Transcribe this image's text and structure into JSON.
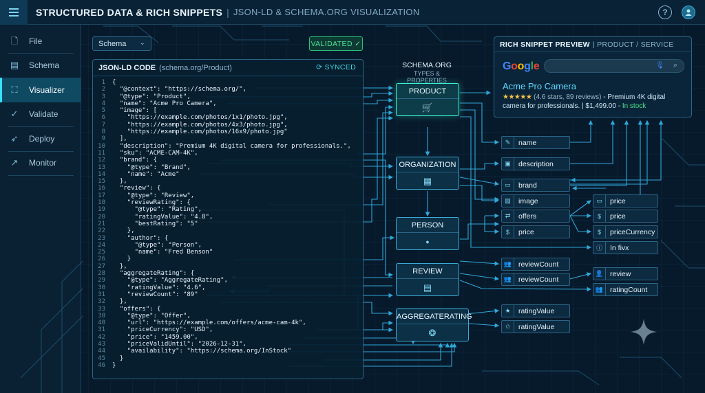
{
  "header": {
    "title": "STRUCTURED DATA & RICH SNIPPETS",
    "separator": "|",
    "subtitle": "JSON-LD & SCHEMA.ORG VISUALIZATION",
    "help_icon": "?",
    "icons": [
      "menu-icon",
      "help-icon",
      "user-icon"
    ]
  },
  "sidebar": {
    "items": [
      {
        "label": "File",
        "icon": "file-icon",
        "glyph": "🗋"
      },
      {
        "label": "Schema",
        "icon": "schema-icon",
        "glyph": "▤"
      },
      {
        "label": "Visualizer",
        "icon": "visualizer-icon",
        "glyph": "⛶"
      },
      {
        "label": "Validate",
        "icon": "check-circle-icon",
        "glyph": "✓"
      },
      {
        "label": "Deploy",
        "icon": "rocket-icon",
        "glyph": "➶"
      },
      {
        "label": "Monitor",
        "icon": "chart-icon",
        "glyph": "↗"
      }
    ],
    "active": "Visualizer"
  },
  "toolbar": {
    "schema_select": "Schema",
    "validated": "VALIDATED ✓"
  },
  "code_panel": {
    "title": "JSON-LD CODE",
    "subtitle": "(schema.org/Product)",
    "synced": "⟳ SYNCED",
    "lines": [
      {
        "n": "1",
        "t": "{"
      },
      {
        "n": "2",
        "t": "  \"@context\": \"https://schema.org/\","
      },
      {
        "n": "3",
        "t": "  \"@type\": \"Product\","
      },
      {
        "n": "4",
        "t": "  \"name\": \"Acme Pro Camera\","
      },
      {
        "n": "5",
        "t": "  \"image\": ["
      },
      {
        "n": "6",
        "t": "    \"https://example.com/photos/1x1/photo.jpg\","
      },
      {
        "n": "7",
        "t": "    \"https://example.com/photos/4x3/photo.jpg\","
      },
      {
        "n": "8",
        "t": "    \"https://example.com/photos/16x9/photo.jpg\""
      },
      {
        "n": "9",
        "t": "  ],"
      },
      {
        "n": "10",
        "t": "  \"description\": \"Premium 4K digital camera for professionals.\","
      },
      {
        "n": "11",
        "t": "  \"sku\": \"ACME-CAM-4K\","
      },
      {
        "n": "12",
        "t": "  \"brand\": {"
      },
      {
        "n": "13",
        "t": "    \"@type\": \"Brand\","
      },
      {
        "n": "14",
        "t": "    \"name\": \"Acme\""
      },
      {
        "n": "15",
        "t": "  },"
      },
      {
        "n": "16",
        "t": "  \"review\": {"
      },
      {
        "n": "17",
        "t": "    \"@type\": \"Review\","
      },
      {
        "n": "18",
        "t": "    \"reviewRating\": {"
      },
      {
        "n": "19",
        "t": "      \"@type\": \"Rating\","
      },
      {
        "n": "20",
        "t": "      \"ratingValue\": \"4.8\","
      },
      {
        "n": "21",
        "t": "      \"bestRating\": \"5\""
      },
      {
        "n": "22",
        "t": "    },"
      },
      {
        "n": "23",
        "t": "    \"author\": {"
      },
      {
        "n": "24",
        "t": "      \"@type\": \"Person\","
      },
      {
        "n": "25",
        "t": "      \"name\": \"Fred Benson\""
      },
      {
        "n": "26",
        "t": "    }"
      },
      {
        "n": "27",
        "t": "  },"
      },
      {
        "n": "28",
        "t": "  \"aggregateRating\": {"
      },
      {
        "n": "29",
        "t": "    \"@type\": \"AggregateRating\","
      },
      {
        "n": "30",
        "t": "    \"ratingValue\": \"4.6\","
      },
      {
        "n": "31",
        "t": "    \"reviewCount\": \"89\""
      },
      {
        "n": "32",
        "t": "  },"
      },
      {
        "n": "33",
        "t": "  \"offers\": {"
      },
      {
        "n": "38",
        "t": "    \"@type\": \"Offer\","
      },
      {
        "n": "40",
        "t": "    \"url\": \"https://example.com/offers/acme-cam-4k\","
      },
      {
        "n": "31",
        "t": "    \"priceCurrency\": \"USD\","
      },
      {
        "n": "42",
        "t": "    \"price\": \"1459.00\","
      },
      {
        "n": "43",
        "t": "    \"priceValidUntil\": \"2026-12-31\","
      },
      {
        "n": "44",
        "t": "    \"availability\": \"https://schema.org/InStock\""
      },
      {
        "n": "45",
        "t": "  }"
      },
      {
        "n": "46",
        "t": "}"
      }
    ]
  },
  "schema_column": {
    "title": "SCHEMA.ORG",
    "subtitle": "TYPES & PROPERTIES",
    "nodes": [
      {
        "label": "PRODUCT",
        "icon": "cart-icon",
        "glyph": "🛒"
      },
      {
        "label": "ORGANIZATION",
        "icon": "building-icon",
        "glyph": "▦"
      },
      {
        "label": "PERSON",
        "icon": "person-icon",
        "glyph": "●"
      },
      {
        "label": "REVIEW",
        "icon": "comment-icon",
        "glyph": "▤"
      },
      {
        "label": "AGGREGATERATING",
        "icon": "rating-icon",
        "glyph": "❂"
      }
    ]
  },
  "properties": {
    "col1": [
      {
        "label": "name",
        "icon": "pencil-icon",
        "glyph": "✎"
      },
      {
        "label": "description",
        "icon": "text-icon",
        "glyph": "▣"
      },
      {
        "label": "brand",
        "icon": "tag-icon",
        "glyph": "▭"
      },
      {
        "label": "image",
        "icon": "image-icon",
        "glyph": "▨"
      },
      {
        "label": "offers",
        "icon": "offer-icon",
        "glyph": "⇄"
      },
      {
        "label": "price",
        "icon": "dollar-icon",
        "glyph": "$"
      },
      {
        "label": "reviewCount",
        "icon": "people-icon",
        "glyph": "👥"
      },
      {
        "label": "reviewCount",
        "icon": "people-icon",
        "glyph": "👥"
      },
      {
        "label": "ratingValue",
        "icon": "star-icon",
        "glyph": "★"
      },
      {
        "label": "ratingValue",
        "icon": "stars-icon",
        "glyph": "✩"
      }
    ],
    "col2": [
      {
        "label": "price",
        "icon": "card-icon",
        "glyph": "▭"
      },
      {
        "label": "price",
        "icon": "dollar-icon",
        "glyph": "$"
      },
      {
        "label": "priceCurrency",
        "icon": "dollar-icon",
        "glyph": "$"
      },
      {
        "label": "In fivx",
        "icon": "info-icon",
        "glyph": "ⓘ"
      },
      {
        "label": "review",
        "icon": "person-icon",
        "glyph": "👤"
      },
      {
        "label": "ratingCount",
        "icon": "people-icon",
        "glyph": "👥"
      }
    ]
  },
  "snippet": {
    "title": "RICH SNIPPET PREVIEW",
    "subtitle": "| PRODUCT / SERVICE",
    "google_letters": [
      "G",
      "o",
      "o",
      "g",
      "l",
      "e"
    ],
    "mic": "🎙",
    "search": "⌕",
    "result_title": "Acme Pro Camera",
    "stars": "★★★★★",
    "rating_text": "(4.6 stars, 89 reviews)",
    "desc_text": "- Premium 4K digital camera for professionals. | $1,499.00 -",
    "in_stock": "In stock"
  },
  "colors": {
    "accent": "#38e0ff",
    "active_node": "#3df2d2",
    "validated": "#52e39a",
    "wire": "#2fa7d9"
  }
}
